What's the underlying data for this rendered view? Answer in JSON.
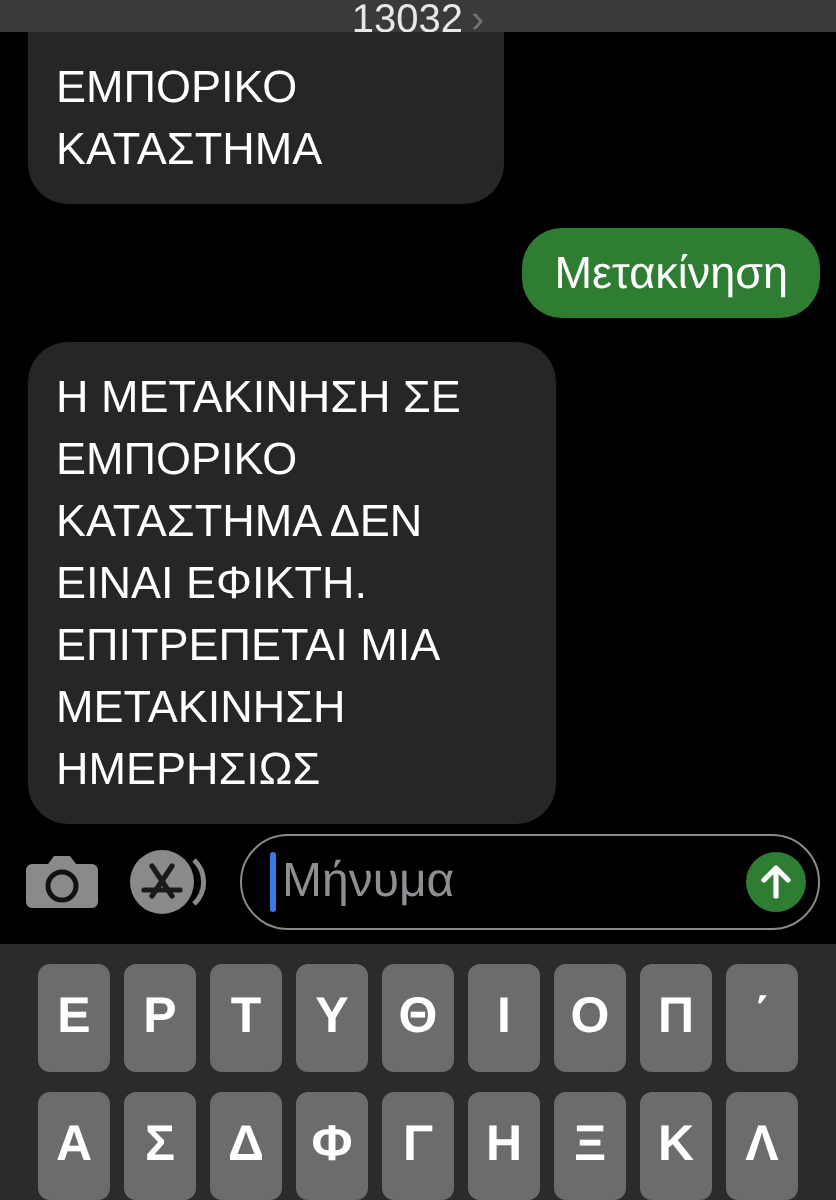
{
  "header": {
    "title": "13032",
    "chevron": "›"
  },
  "messages": [
    {
      "kind": "received",
      "text": "ΕΜΠΟΡΙΚΟ ΚΑΤΑΣΤΗΜΑ"
    },
    {
      "kind": "sent",
      "text": "Μετακίνηση"
    },
    {
      "kind": "received",
      "text": "Η ΜΕΤΑΚΙΝΗΣΗ ΣΕ ΕΜΠΟΡΙΚΟ ΚΑΤΑΣΤΗΜΑ ΔΕΝ ΕΙΝΑΙ ΕΦΙΚΤΗ. ΕΠΙΤΡΕΠΕΤΑΙ ΜΙΑ ΜΕΤΑΚΙΝΗΣΗ ΗΜΕΡΗΣΙΩΣ"
    }
  ],
  "compose": {
    "placeholder": "Μήνυμα",
    "focused": true
  },
  "keyboard": [
    [
      "Ε",
      "Ρ",
      "Τ",
      "Υ",
      "Θ",
      "Ι",
      "Ο",
      "Π",
      "΄"
    ],
    [
      "Α",
      "Σ",
      "Δ",
      "Φ",
      "Γ",
      "Η",
      "Ξ",
      "Κ",
      "Λ"
    ]
  ]
}
